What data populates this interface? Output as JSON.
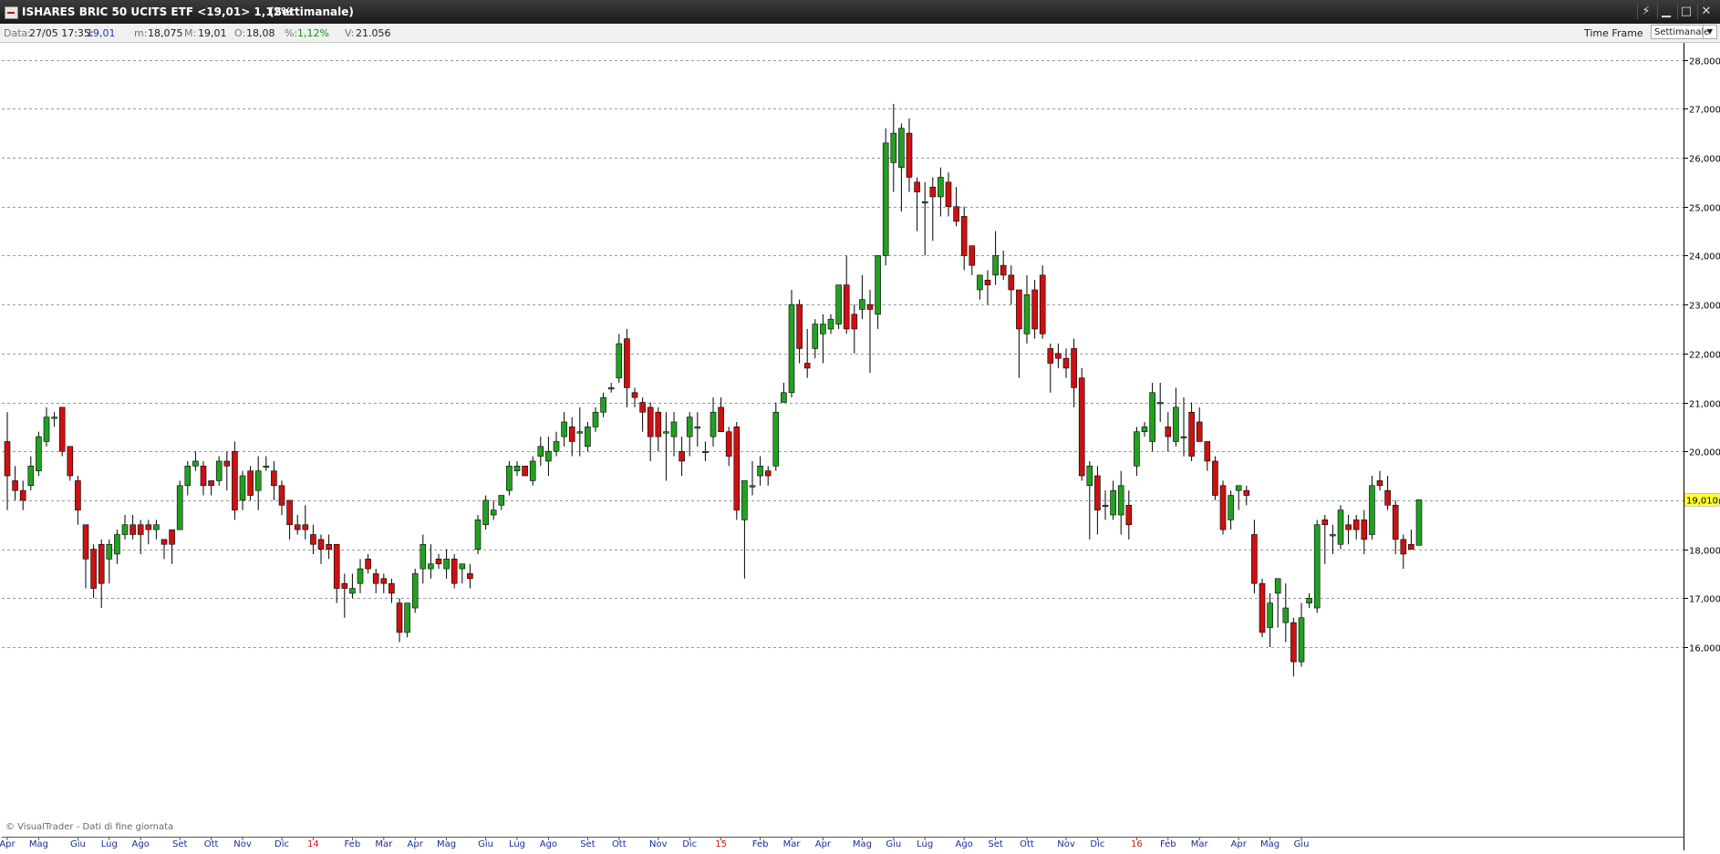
{
  "window": {
    "title": "ISHARES BRIC 50 UCITS ETF <19,01> 1,12%",
    "timeframe_label": "(Settimanale)",
    "buttons": [
      "pin-icon",
      "minimize-icon",
      "maximize-icon",
      "close-icon"
    ]
  },
  "infobar": {
    "data_label": "Data:",
    "data_value": "27/05 17:35:",
    "data_price": "19,01",
    "min_label": "m:",
    "min_value": "18,075",
    "max_label": "M:",
    "max_value": "19,01",
    "open_label": "O:",
    "open_value": "18,08",
    "pct_label": "%:",
    "pct_value": "1,12%",
    "vol_label": "V:",
    "vol_value": "21.056",
    "timeframe_label": "Time Frame",
    "timeframe_value": "Settimanale"
  },
  "watermark": "© VisualTrader - Dati di fine giornata",
  "colors": {
    "up": "#22a022",
    "down": "#cc1111",
    "current_price_bg": "#ffff33"
  },
  "chart_data": {
    "type": "candlestick",
    "title": "",
    "xlabel": "",
    "ylabel": "",
    "ylim": [
      15.3,
      28.3
    ],
    "yticks": [
      "16,000",
      "17,000",
      "18,000",
      "19,000",
      "20,000",
      "21,000",
      "22,000",
      "23,000",
      "24,000",
      "25,000",
      "26,000",
      "27,000",
      "28,000"
    ],
    "ytick_values": [
      16,
      17,
      18,
      19,
      20,
      21,
      22,
      23,
      24,
      25,
      26,
      27,
      28
    ],
    "current_price": 19.01,
    "current_price_label": "19,010",
    "grid": true,
    "xticks": [
      {
        "label": "Apr",
        "i": 0
      },
      {
        "label": "Mag",
        "i": 4
      },
      {
        "label": "Giu",
        "i": 9
      },
      {
        "label": "Lug",
        "i": 13
      },
      {
        "label": "Ago",
        "i": 17
      },
      {
        "label": "Set",
        "i": 22
      },
      {
        "label": "Ott",
        "i": 26
      },
      {
        "label": "Nov",
        "i": 30
      },
      {
        "label": "Dic",
        "i": 35
      },
      {
        "label": "14",
        "i": 39,
        "year": true
      },
      {
        "label": "Feb",
        "i": 44
      },
      {
        "label": "Mar",
        "i": 48
      },
      {
        "label": "Apr",
        "i": 52
      },
      {
        "label": "Mag",
        "i": 56
      },
      {
        "label": "Giu",
        "i": 61
      },
      {
        "label": "Lug",
        "i": 65
      },
      {
        "label": "Ago",
        "i": 69
      },
      {
        "label": "Set",
        "i": 74
      },
      {
        "label": "Ott",
        "i": 78
      },
      {
        "label": "Nov",
        "i": 83
      },
      {
        "label": "Dic",
        "i": 87
      },
      {
        "label": "15",
        "i": 91,
        "year": true
      },
      {
        "label": "Feb",
        "i": 96
      },
      {
        "label": "Mar",
        "i": 100
      },
      {
        "label": "Apr",
        "i": 104
      },
      {
        "label": "Mag",
        "i": 109
      },
      {
        "label": "Giu",
        "i": 113
      },
      {
        "label": "Lug",
        "i": 117
      },
      {
        "label": "Ago",
        "i": 122
      },
      {
        "label": "Set",
        "i": 126
      },
      {
        "label": "Ott",
        "i": 130
      },
      {
        "label": "Nov",
        "i": 135
      },
      {
        "label": "Dic",
        "i": 139
      },
      {
        "label": "16",
        "i": 144,
        "year": true
      },
      {
        "label": "Feb",
        "i": 148
      },
      {
        "label": "Mar",
        "i": 152
      },
      {
        "label": "Apr",
        "i": 157
      },
      {
        "label": "Mag",
        "i": 161
      },
      {
        "label": "Giu",
        "i": 165
      }
    ],
    "ohlc": [
      [
        20.2,
        20.8,
        18.8,
        19.5
      ],
      [
        19.4,
        19.7,
        19.0,
        19.2
      ],
      [
        19.2,
        19.4,
        18.8,
        19.0
      ],
      [
        19.3,
        19.9,
        19.2,
        19.7
      ],
      [
        19.6,
        20.4,
        19.5,
        20.3
      ],
      [
        20.2,
        20.9,
        20.1,
        20.7
      ],
      [
        20.7,
        20.8,
        20.5,
        20.7
      ],
      [
        20.9,
        20.9,
        19.9,
        20.0
      ],
      [
        20.1,
        20.1,
        19.4,
        19.5
      ],
      [
        19.4,
        19.5,
        18.5,
        18.8
      ],
      [
        18.5,
        18.5,
        17.2,
        17.8
      ],
      [
        18.0,
        18.1,
        17.0,
        17.2
      ],
      [
        18.1,
        18.2,
        16.8,
        17.3
      ],
      [
        17.8,
        18.2,
        17.3,
        18.1
      ],
      [
        17.9,
        18.4,
        17.7,
        18.3
      ],
      [
        18.3,
        18.7,
        18.2,
        18.5
      ],
      [
        18.5,
        18.7,
        18.2,
        18.3
      ],
      [
        18.5,
        18.6,
        17.9,
        18.3
      ],
      [
        18.5,
        18.6,
        18.1,
        18.4
      ],
      [
        18.4,
        18.6,
        18.2,
        18.5
      ],
      [
        18.2,
        18.2,
        17.8,
        18.1
      ],
      [
        18.4,
        18.4,
        17.7,
        18.1
      ],
      [
        18.4,
        19.4,
        18.4,
        19.3
      ],
      [
        19.3,
        19.8,
        19.1,
        19.7
      ],
      [
        19.7,
        20.0,
        19.6,
        19.8
      ],
      [
        19.7,
        19.8,
        19.1,
        19.3
      ],
      [
        19.4,
        19.4,
        19.1,
        19.3
      ],
      [
        19.4,
        19.9,
        19.3,
        19.8
      ],
      [
        19.8,
        20.0,
        19.2,
        19.7
      ],
      [
        20.0,
        20.2,
        18.6,
        18.8
      ],
      [
        19.0,
        19.6,
        18.8,
        19.5
      ],
      [
        19.6,
        19.7,
        19.0,
        19.1
      ],
      [
        19.2,
        19.9,
        18.8,
        19.6
      ],
      [
        19.7,
        19.9,
        19.6,
        19.7
      ],
      [
        19.6,
        19.8,
        19.0,
        19.3
      ],
      [
        19.3,
        19.4,
        18.7,
        18.9
      ],
      [
        19.0,
        19.0,
        18.2,
        18.5
      ],
      [
        18.5,
        18.7,
        18.3,
        18.4
      ],
      [
        18.5,
        18.9,
        18.2,
        18.4
      ],
      [
        18.3,
        18.5,
        17.9,
        18.1
      ],
      [
        18.2,
        18.3,
        17.7,
        18.0
      ],
      [
        18.1,
        18.3,
        17.8,
        18.0
      ],
      [
        18.1,
        18.1,
        16.9,
        17.2
      ],
      [
        17.3,
        17.5,
        16.6,
        17.2
      ],
      [
        17.1,
        17.5,
        17.0,
        17.2
      ],
      [
        17.3,
        17.8,
        17.1,
        17.6
      ],
      [
        17.8,
        17.9,
        17.5,
        17.6
      ],
      [
        17.5,
        17.6,
        17.1,
        17.3
      ],
      [
        17.4,
        17.5,
        17.1,
        17.3
      ],
      [
        17.3,
        17.4,
        16.9,
        17.1
      ],
      [
        16.9,
        17.0,
        16.1,
        16.3
      ],
      [
        16.3,
        16.9,
        16.2,
        16.9
      ],
      [
        16.8,
        17.6,
        16.7,
        17.5
      ],
      [
        17.6,
        18.3,
        17.3,
        18.1
      ],
      [
        17.6,
        18.1,
        17.4,
        17.7
      ],
      [
        17.8,
        17.9,
        17.6,
        17.7
      ],
      [
        17.6,
        18.0,
        17.4,
        17.8
      ],
      [
        17.8,
        17.9,
        17.2,
        17.3
      ],
      [
        17.6,
        17.7,
        17.3,
        17.7
      ],
      [
        17.5,
        17.7,
        17.2,
        17.4
      ],
      [
        18.0,
        18.7,
        17.9,
        18.6
      ],
      [
        18.5,
        19.1,
        18.4,
        19.0
      ],
      [
        18.7,
        19.0,
        18.6,
        18.8
      ],
      [
        18.9,
        19.1,
        18.8,
        19.1
      ],
      [
        19.2,
        19.8,
        19.1,
        19.7
      ],
      [
        19.6,
        19.8,
        19.5,
        19.7
      ],
      [
        19.7,
        19.7,
        19.5,
        19.5
      ],
      [
        19.4,
        19.9,
        19.3,
        19.8
      ],
      [
        19.9,
        20.3,
        19.7,
        20.1
      ],
      [
        19.8,
        20.3,
        19.5,
        20.0
      ],
      [
        20.0,
        20.4,
        19.9,
        20.2
      ],
      [
        20.3,
        20.8,
        20.1,
        20.6
      ],
      [
        20.5,
        20.7,
        19.9,
        20.2
      ],
      [
        20.4,
        20.9,
        19.9,
        20.4
      ],
      [
        20.1,
        20.6,
        20.0,
        20.5
      ],
      [
        20.5,
        20.9,
        20.4,
        20.8
      ],
      [
        20.8,
        21.2,
        20.7,
        21.1
      ],
      [
        21.3,
        21.4,
        21.2,
        21.3
      ],
      [
        21.5,
        22.4,
        21.4,
        22.2
      ],
      [
        22.3,
        22.5,
        20.9,
        21.3
      ],
      [
        21.2,
        21.3,
        20.9,
        21.1
      ],
      [
        21.0,
        21.1,
        20.4,
        20.8
      ],
      [
        20.9,
        21.0,
        19.8,
        20.3
      ],
      [
        20.8,
        20.9,
        20.0,
        20.3
      ],
      [
        20.4,
        20.8,
        19.4,
        20.4
      ],
      [
        20.3,
        20.8,
        19.9,
        20.6
      ],
      [
        20.0,
        20.3,
        19.5,
        19.8
      ],
      [
        20.3,
        20.8,
        19.9,
        20.7
      ],
      [
        20.5,
        20.8,
        20.1,
        20.5
      ],
      [
        20.0,
        20.2,
        19.8,
        20.0
      ],
      [
        20.3,
        21.1,
        20.1,
        20.8
      ],
      [
        20.9,
        21.1,
        20.4,
        20.4
      ],
      [
        20.4,
        20.5,
        19.7,
        19.9
      ],
      [
        20.5,
        20.6,
        18.6,
        18.8
      ],
      [
        18.6,
        19.4,
        17.4,
        19.4
      ],
      [
        19.3,
        19.8,
        19.1,
        19.3
      ],
      [
        19.5,
        19.9,
        19.3,
        19.7
      ],
      [
        19.6,
        19.7,
        19.3,
        19.5
      ],
      [
        19.7,
        21.0,
        19.6,
        20.8
      ],
      [
        21.0,
        21.4,
        21.0,
        21.2
      ],
      [
        21.2,
        23.3,
        21.1,
        23.0
      ],
      [
        23.0,
        23.1,
        21.8,
        22.1
      ],
      [
        21.8,
        22.5,
        21.5,
        21.7
      ],
      [
        22.1,
        22.7,
        21.9,
        22.6
      ],
      [
        22.4,
        22.8,
        21.8,
        22.6
      ],
      [
        22.5,
        22.8,
        22.4,
        22.7
      ],
      [
        22.6,
        23.4,
        22.5,
        23.4
      ],
      [
        23.4,
        24.0,
        22.4,
        22.5
      ],
      [
        22.8,
        23.0,
        22.0,
        22.5
      ],
      [
        22.9,
        23.6,
        22.7,
        23.1
      ],
      [
        23.0,
        23.3,
        21.6,
        22.9
      ],
      [
        22.8,
        24.0,
        22.5,
        24.0
      ],
      [
        24.0,
        26.6,
        23.8,
        26.3
      ],
      [
        25.9,
        27.1,
        25.3,
        26.5
      ],
      [
        25.8,
        26.7,
        24.9,
        26.6
      ],
      [
        26.5,
        26.8,
        25.3,
        25.6
      ],
      [
        25.5,
        25.6,
        24.5,
        25.3
      ],
      [
        25.1,
        25.5,
        24.0,
        25.1
      ],
      [
        25.4,
        25.6,
        24.3,
        25.2
      ],
      [
        25.2,
        25.8,
        24.8,
        25.6
      ],
      [
        25.5,
        25.7,
        24.8,
        25.0
      ],
      [
        25.0,
        25.4,
        24.6,
        24.7
      ],
      [
        24.8,
        25.0,
        23.7,
        24.0
      ],
      [
        24.2,
        24.2,
        23.6,
        23.8
      ],
      [
        23.3,
        23.6,
        23.1,
        23.6
      ],
      [
        23.5,
        23.7,
        23.0,
        23.4
      ],
      [
        23.6,
        24.5,
        23.4,
        24.0
      ],
      [
        23.8,
        24.1,
        23.5,
        23.6
      ],
      [
        23.6,
        23.8,
        23.0,
        23.3
      ],
      [
        23.3,
        23.3,
        21.5,
        22.5
      ],
      [
        22.4,
        23.6,
        22.2,
        23.2
      ],
      [
        23.3,
        23.5,
        22.3,
        22.5
      ],
      [
        23.6,
        23.8,
        22.3,
        22.4
      ],
      [
        22.1,
        22.2,
        21.2,
        21.8
      ],
      [
        22.0,
        22.2,
        21.7,
        21.9
      ],
      [
        21.9,
        22.1,
        21.5,
        21.7
      ],
      [
        22.1,
        22.3,
        20.9,
        21.3
      ],
      [
        21.5,
        21.7,
        19.4,
        19.5
      ],
      [
        19.3,
        19.8,
        18.2,
        19.7
      ],
      [
        19.5,
        19.7,
        18.3,
        18.8
      ],
      [
        18.9,
        19.2,
        18.6,
        18.9
      ],
      [
        18.7,
        19.4,
        18.6,
        19.2
      ],
      [
        18.7,
        19.6,
        18.3,
        19.3
      ],
      [
        18.9,
        19.2,
        18.2,
        18.5
      ],
      [
        19.7,
        20.5,
        19.5,
        20.4
      ],
      [
        20.4,
        20.6,
        20.3,
        20.5
      ],
      [
        20.2,
        21.4,
        20.0,
        21.2
      ],
      [
        21.0,
        21.4,
        20.6,
        21.0
      ],
      [
        20.5,
        20.8,
        20.0,
        20.3
      ],
      [
        20.2,
        21.3,
        20.1,
        20.9
      ],
      [
        20.3,
        21.1,
        19.9,
        20.3
      ],
      [
        20.8,
        21.0,
        19.8,
        19.9
      ],
      [
        20.6,
        20.9,
        20.3,
        20.2
      ],
      [
        20.2,
        20.2,
        19.6,
        19.8
      ],
      [
        19.8,
        19.9,
        19.0,
        19.1
      ],
      [
        19.3,
        19.4,
        18.3,
        18.4
      ],
      [
        18.6,
        19.2,
        18.4,
        19.1
      ],
      [
        19.2,
        19.3,
        18.8,
        19.3
      ],
      [
        19.2,
        19.3,
        18.9,
        19.1
      ],
      [
        18.3,
        18.6,
        17.1,
        17.3
      ],
      [
        17.3,
        17.4,
        16.2,
        16.3
      ],
      [
        16.4,
        17.1,
        16.0,
        16.9
      ],
      [
        17.1,
        17.4,
        16.4,
        17.4
      ],
      [
        16.5,
        17.3,
        16.1,
        16.8
      ],
      [
        16.5,
        16.6,
        15.4,
        15.7
      ],
      [
        15.7,
        16.9,
        15.6,
        16.6
      ],
      [
        16.9,
        17.1,
        16.8,
        17.0
      ],
      [
        16.8,
        18.6,
        16.7,
        18.5
      ],
      [
        18.6,
        18.7,
        17.7,
        18.5
      ],
      [
        18.3,
        18.5,
        17.9,
        18.3
      ],
      [
        18.1,
        18.9,
        18.0,
        18.8
      ],
      [
        18.5,
        18.7,
        18.1,
        18.4
      ],
      [
        18.6,
        18.7,
        18.2,
        18.4
      ],
      [
        18.6,
        18.8,
        17.9,
        18.2
      ],
      [
        18.3,
        19.5,
        18.2,
        19.3
      ],
      [
        19.4,
        19.6,
        19.2,
        19.3
      ],
      [
        19.2,
        19.5,
        18.8,
        18.9
      ],
      [
        18.9,
        19.0,
        17.9,
        18.2
      ],
      [
        18.2,
        18.3,
        17.6,
        17.9
      ],
      [
        18.1,
        18.4,
        18.0,
        18.0
      ],
      [
        18.08,
        19.01,
        18.075,
        19.01
      ]
    ]
  }
}
